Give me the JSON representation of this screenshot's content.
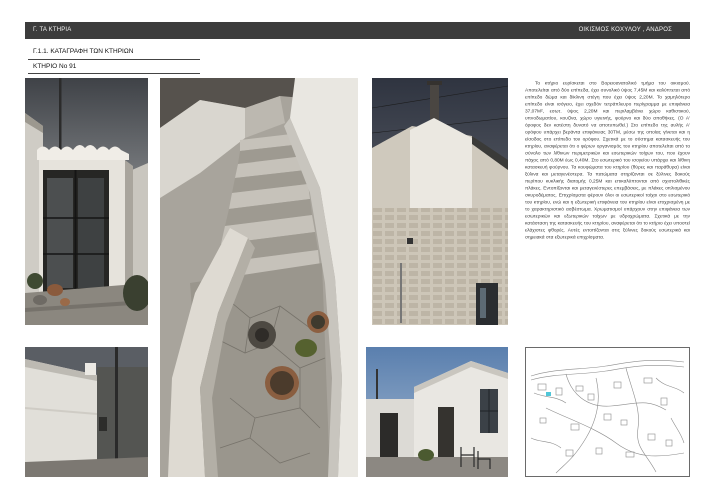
{
  "header": {
    "section": "Γ. ΤΑ ΚΤΗΡΙΑ",
    "settlement": "ΟΙΚΙΣΜΟΣ ΚΟΧΥΛΟΥ , ΑΝΔΡΟΣ"
  },
  "heading": {
    "title": "Γ.1.1. ΚΑΤΑΓΡΑΦΗ ΤΩΝ ΚΤΗΡΙΩΝ",
    "building": "ΚΤΗΡΙΟ Νο 91"
  },
  "description": "Το κτήριο ευρίσκεται στο Βορειοανατολικό τμήμα του οικισμού. Αποτελείται από δύο επίπεδα, έχει συνολικό ύψος 7,45Μ και καλύπτεται από επίπεδο δώμα και δίκλινη στέγη που έχει ύψος 2,20Μ. Το χαμηλότερο επίπεδο είναι ισόγειο, έχει σχεδόν τετράπλευρο περίγραμμα με επιφάνεια 37,07Μ², εσωτ. ύψος 2,20Μ και περιλαμβάνει χώρο καθιστικού, υπνοδωματίου, κουζίνα, χώρο υγιεινής, φούρνο και δύο αποθήκες. (Ο Α' όροφος δεν κατέστη δυνατό να αποτυπωθεί.) Στο επίπεδο της αυλής Α' ορόφου υπάρχει βεράντα επιφάνειας 30ΤΜ, μέσω της οποίας γίνεται και η είσοδος στο επίπεδο του ορόφου. Σχετικά με το σύστημα κατασκευής του κτηρίου, αναφέρεται ότι ο φέρων οργανισμός του κτηρίου αποτελείται από το σύνολο των λίθινων περιμετρικών και εσωτερικών τοίχων του, που έχουν πάχος από 0,80Μ έως 0,40Μ. Στο εσωτερικό του ισογείου υπάρχει και λίθινη κατασκευή φούρνου. Τα κουφώματα του κτηρίου (θύρες και παράθυρα) είναι ξύλινα και μεταγενέστερα. Τα πατώματα στηρίζονται σε ξύλινες δοκούς περίπου κυκλικής διατομής 0,25Μ και επικαλύπτονται από σχιστολιθικές πλάκες. Εντοπίζονται και μεταγενέστερες επεμβάσεις, με πλάκες οπλισμένου σκυροδέματος. Επιχρίσματα φέρουν όλοι οι εσωτερικοί τοίχοι στο εσωτερικό του κτηρίου, ενώ και η εξωτερική επιφάνεια του κτηρίου είναι επιχρισμένη με το χαρακτηριστικό ασβέστωμα. Χρωματισμοί υπάρχουν στην επιφάνεια των εσωτερικών και εξωτερικών τοίχων με υδροχρώματα. Σχετικά με την κατάσταση της κατασκευής του κτηρίου, αναφέρεται ότι το κτήριο έχει υποστεί ελάχιστες φθορές. Αυτές εντοπίζονται στις ξύλινες δοκούς εσωτερικά και σημειακά στα εξωτερικά επιχρίσματα.",
  "colors": {
    "header_bar": "#3c3c3c",
    "page_background": "#ffffff",
    "map_highlight": "#4fc6d8"
  }
}
